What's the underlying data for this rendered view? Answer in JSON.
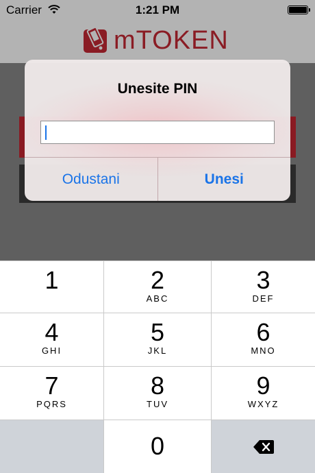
{
  "status_bar": {
    "carrier": "Carrier",
    "time": "1:21 PM"
  },
  "app": {
    "logo_text": "mTOKEN",
    "brand_color": "#8a1c24"
  },
  "dialog": {
    "title": "Unesite PIN",
    "pin_value": "",
    "cancel_label": "Odustani",
    "confirm_label": "Unesi",
    "button_color": "#1a74e8"
  },
  "keypad": {
    "keys": [
      {
        "num": "1",
        "letters": ""
      },
      {
        "num": "2",
        "letters": "ABC"
      },
      {
        "num": "3",
        "letters": "DEF"
      },
      {
        "num": "4",
        "letters": "GHI"
      },
      {
        "num": "5",
        "letters": "JKL"
      },
      {
        "num": "6",
        "letters": "MNO"
      },
      {
        "num": "7",
        "letters": "PQRS"
      },
      {
        "num": "8",
        "letters": "TUV"
      },
      {
        "num": "9",
        "letters": "WXYZ"
      },
      {
        "num": "0",
        "letters": ""
      }
    ],
    "backspace_icon": "backspace-icon"
  }
}
